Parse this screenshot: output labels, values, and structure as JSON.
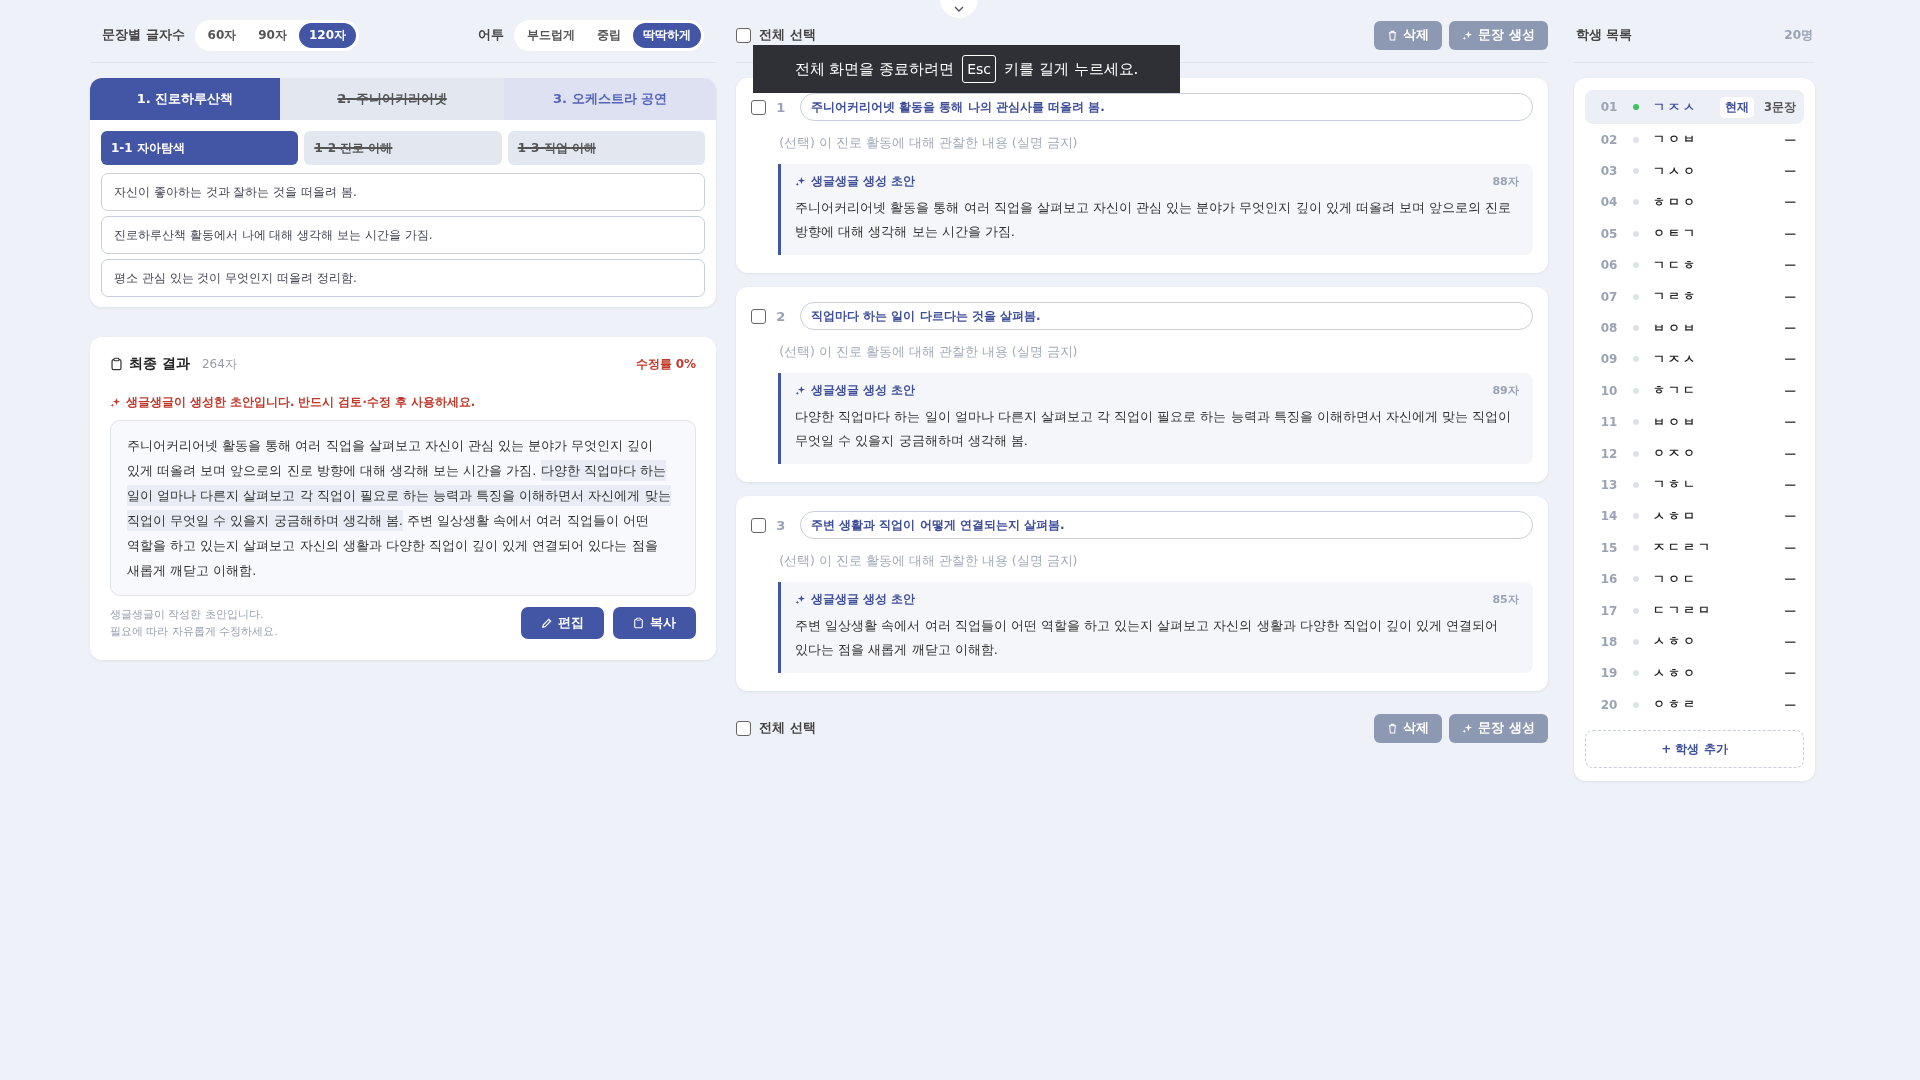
{
  "toolbar": {
    "length_label": "문장별 글자수",
    "lengths": [
      {
        "label": "60자",
        "selected": false
      },
      {
        "label": "90자",
        "selected": false
      },
      {
        "label": "120자",
        "selected": true
      }
    ],
    "tone_label": "어투",
    "tones": [
      {
        "label": "부드럽게",
        "selected": false
      },
      {
        "label": "중립",
        "selected": false
      },
      {
        "label": "딱딱하게",
        "selected": true
      }
    ]
  },
  "activity_tabs": [
    {
      "label": "1. 진로하루산책",
      "selected": true,
      "struck": false
    },
    {
      "label": "2. 주니어커리어넷",
      "selected": false,
      "struck": true
    },
    {
      "label": "3. 오케스트라 공연",
      "selected": false,
      "struck": false
    }
  ],
  "sub_tabs": [
    {
      "label": "1-1 자아탐색",
      "selected": true,
      "struck": false
    },
    {
      "label": "1-2 진로 이해",
      "selected": false,
      "struck": true
    },
    {
      "label": "1-3 직업 이해",
      "selected": false,
      "struck": true
    }
  ],
  "options": [
    "자신이 좋아하는 것과 잘하는 것을 떠올려 봄.",
    "진로하루산책 활동에서 나에 대해 생각해 보는 시간을 가짐.",
    "평소 관심 있는 것이 무엇인지 떠올려 정리함."
  ],
  "result": {
    "title": "최종 결과",
    "count": "264자",
    "edit_rate": "수정률 0%",
    "warning": "생글생글이 생성한 초안입니다. 반드시 검토·수정 후 사용하세요.",
    "segments": [
      {
        "text": "주니어커리어넷 활동을 통해 여러 직업을 살펴보고 자신이 관심 있는 분야가 무엇인지 깊이 있게 떠올려 보며 앞으로의 진로 방향에 대해 생각해 보는 시간을 가짐.",
        "highlighted": false
      },
      {
        "text": "다양한 직업마다 하는 일이 얼마나 다른지 살펴보고 각 직업이 필요로 하는 능력과 특징을 이해하면서 자신에게 맞는 직업이 무엇일 수 있을지 궁금해하며 생각해 봄.",
        "highlighted": true
      },
      {
        "text": "주변 일상생활 속에서 여러 직업들이 어떤 역할을 하고 있는지 살펴보고 자신의 생활과 다양한 직업이 깊이 있게 연결되어 있다는 점을 새롭게 깨닫고 이해함.",
        "highlighted": false
      }
    ],
    "note_lines": [
      "생글생글이 작성한 초안입니다.",
      "필요에 따라 자유롭게 수정하세요."
    ],
    "edit_button": "편집",
    "copy_button": "복사"
  },
  "sentences_header": {
    "select_all": "전체 선택",
    "checked": false,
    "delete_button": "삭제",
    "generate_button": "문장 생성"
  },
  "sentences": [
    {
      "number": "1",
      "checked": false,
      "topic": "주니어커리어넷 활동을 통해 나의 관심사를 떠올려 봄.",
      "observation_placeholder": "(선택) 이 진로 활동에 대해 관찰한 내용 (실명 금지)",
      "draft_label": "생글생글 생성 초안",
      "draft_count": "88자",
      "draft": "주니어커리어넷 활동을 통해 여러 직업을 살펴보고 자신이 관심 있는 분야가 무엇인지 깊이 있게 떠올려 보며 앞으로의 진로 방향에 대해 생각해 보는 시간을 가짐."
    },
    {
      "number": "2",
      "checked": false,
      "topic": "직업마다 하는 일이 다르다는 것을 살펴봄.",
      "observation_placeholder": "(선택) 이 진로 활동에 대해 관찰한 내용 (실명 금지)",
      "draft_label": "생글생글 생성 초안",
      "draft_count": "89자",
      "draft": "다양한 직업마다 하는 일이 얼마나 다른지 살펴보고 각 직업이 필요로 하는 능력과 특징을 이해하면서 자신에게 맞는 직업이 무엇일 수 있을지 궁금해하며 생각해 봄."
    },
    {
      "number": "3",
      "checked": false,
      "topic": "주변 생활과 직업이 어떻게 연결되는지 살펴봄.",
      "observation_placeholder": "(선택) 이 진로 활동에 대해 관찰한 내용 (실명 금지)",
      "draft_label": "생글생글 생성 초안",
      "draft_count": "85자",
      "draft": "주변 일상생활 속에서 여러 직업들이 어떤 역할을 하고 있는지 살펴보고 자신의 생활과 다양한 직업이 깊이 있게 연결되어 있다는 점을 새롭게 깨닫고 이해함."
    }
  ],
  "sentences_footer": {
    "select_all": "전체 선택",
    "checked": false,
    "delete_button": "삭제",
    "generate_button": "문장 생성"
  },
  "toast": {
    "before": "전체 화면을 종료하려면",
    "key": "Esc",
    "after": "키를 길게 누르세요."
  },
  "students": {
    "title": "학생 목록",
    "count": "20명",
    "add_button": "+ 학생 추가",
    "items": [
      {
        "number": "01",
        "name": "ㄱㅈㅅ",
        "selected": true,
        "color": "#3cc45c",
        "badge": "현재",
        "status": "3문장"
      },
      {
        "number": "02",
        "name": "ㄱㅇㅂ",
        "selected": false,
        "color": "#dde2ea",
        "status": "—"
      },
      {
        "number": "03",
        "name": "ㄱㅅㅇ",
        "selected": false,
        "color": "#dde2ea",
        "status": "—"
      },
      {
        "number": "04",
        "name": "ㅎㅁㅇ",
        "selected": false,
        "color": "#dde2ea",
        "status": "—"
      },
      {
        "number": "05",
        "name": "ㅇㅌㄱ",
        "selected": false,
        "color": "#dde2ea",
        "status": "—"
      },
      {
        "number": "06",
        "name": "ㄱㄷㅎ",
        "selected": false,
        "color": "#dde2ea",
        "status": "—"
      },
      {
        "number": "07",
        "name": "ㄱㄹㅎ",
        "selected": false,
        "color": "#dde2ea",
        "status": "—"
      },
      {
        "number": "08",
        "name": "ㅂㅇㅂ",
        "selected": false,
        "color": "#dde2ea",
        "status": "—"
      },
      {
        "number": "09",
        "name": "ㄱㅈㅅ",
        "selected": false,
        "color": "#dde2ea",
        "status": "—"
      },
      {
        "number": "10",
        "name": "ㅎㄱㄷ",
        "selected": false,
        "color": "#dde2ea",
        "status": "—"
      },
      {
        "number": "11",
        "name": "ㅂㅇㅂ",
        "selected": false,
        "color": "#dde2ea",
        "status": "—"
      },
      {
        "number": "12",
        "name": "ㅇㅈㅇ",
        "selected": false,
        "color": "#dde2ea",
        "status": "—"
      },
      {
        "number": "13",
        "name": "ㄱㅎㄴ",
        "selected": false,
        "color": "#dde2ea",
        "status": "—"
      },
      {
        "number": "14",
        "name": "ㅅㅎㅁ",
        "selected": false,
        "color": "#dde2ea",
        "status": "—"
      },
      {
        "number": "15",
        "name": "ㅈㄷㄹㄱ",
        "selected": false,
        "color": "#dde2ea",
        "status": "—"
      },
      {
        "number": "16",
        "name": "ㄱㅇㄷ",
        "selected": false,
        "color": "#dde2ea",
        "status": "—"
      },
      {
        "number": "17",
        "name": "ㄷㄱㄹㅁ",
        "selected": false,
        "color": "#dde2ea",
        "status": "—"
      },
      {
        "number": "18",
        "name": "ㅅㅎㅇ",
        "selected": false,
        "color": "#dde2ea",
        "status": "—"
      },
      {
        "number": "19",
        "name": "ㅅㅎㅇ",
        "selected": false,
        "color": "#dde2ea",
        "status": "—"
      },
      {
        "number": "20",
        "name": "ㅇㅎㄹ",
        "selected": false,
        "color": "#dde2ea",
        "status": "—"
      }
    ]
  }
}
